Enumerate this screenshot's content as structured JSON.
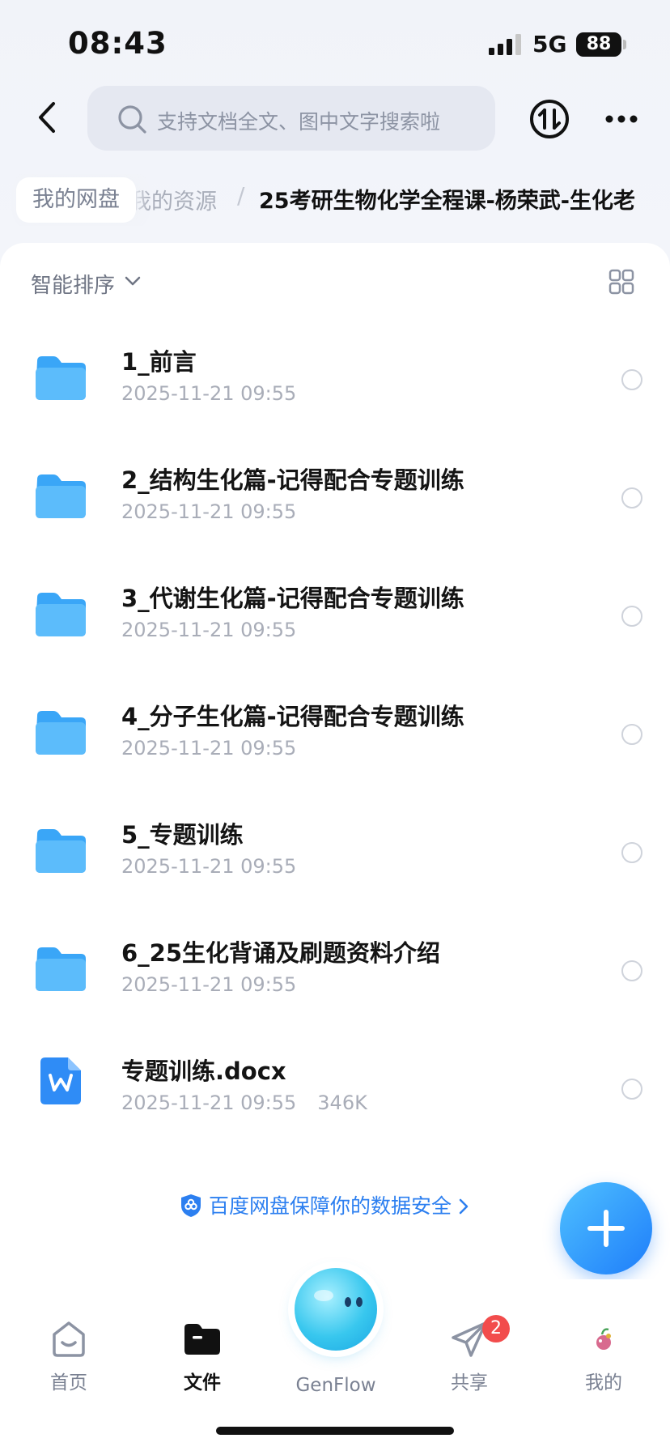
{
  "status_bar": {
    "time": "08:43",
    "network": "5G",
    "battery": "88"
  },
  "search": {
    "placeholder": "支持文档全文、图中文字搜索啦"
  },
  "breadcrumb": {
    "root": "我的网盘",
    "middle": "我的资源",
    "separator": "/",
    "current": "25考研生物化学全程课-杨荣武-生化老"
  },
  "toolbar": {
    "sort_label": "智能排序"
  },
  "files": [
    {
      "name": "1_前言",
      "date": "2025-11-21 09:55",
      "type": "folder"
    },
    {
      "name": "2_结构生化篇-记得配合专题训练",
      "date": "2025-11-21 09:55",
      "type": "folder"
    },
    {
      "name": "3_代谢生化篇-记得配合专题训练",
      "date": "2025-11-21 09:55",
      "type": "folder"
    },
    {
      "name": "4_分子生化篇-记得配合专题训练",
      "date": "2025-11-21 09:55",
      "type": "folder"
    },
    {
      "name": "5_专题训练",
      "date": "2025-11-21 09:55",
      "type": "folder"
    },
    {
      "name": "6_25生化背诵及刷题资料介绍",
      "date": "2025-11-21 09:55",
      "type": "folder"
    },
    {
      "name": "专题训练.docx",
      "date": "2025-11-21 09:55",
      "size": "346K",
      "type": "word-doc"
    }
  ],
  "safety_notice": "百度网盘保障你的数据安全",
  "tabs": [
    {
      "label": "首页",
      "icon": "home-icon"
    },
    {
      "label": "文件",
      "icon": "folder-icon",
      "active": true
    },
    {
      "label": "GenFlow",
      "icon": "genflow-orb"
    },
    {
      "label": "共享",
      "icon": "send-icon",
      "badge": "2"
    },
    {
      "label": "我的",
      "icon": "avatar"
    }
  ],
  "colors": {
    "accent": "#2c7ff0",
    "folder": "#3aa6f7",
    "badge": "#f24c4c"
  }
}
